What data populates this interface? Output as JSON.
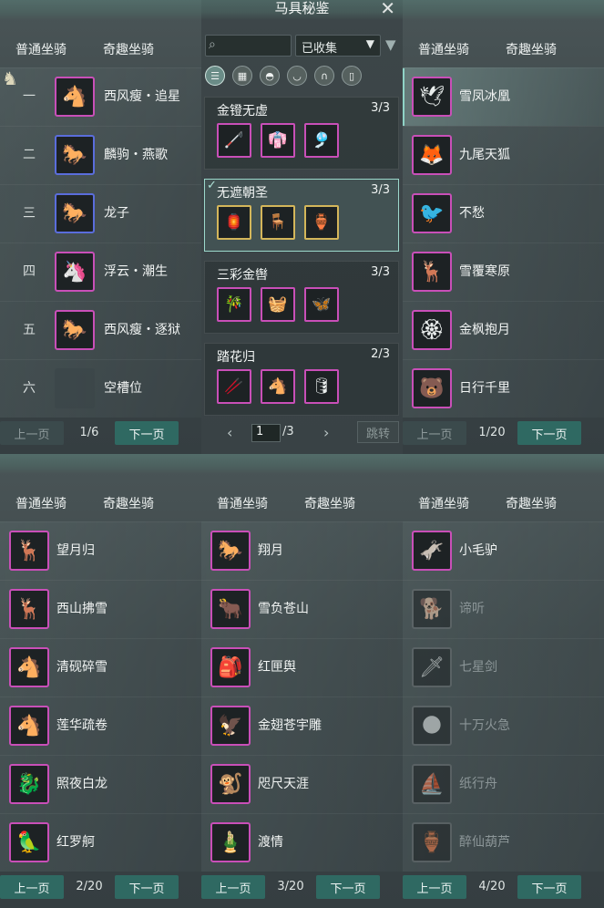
{
  "center": {
    "title": "马具秘鉴",
    "search_placeholder": "",
    "filter_selected": "已收集",
    "category_icons": [
      "list-icon",
      "grid-icon",
      "saddle-icon",
      "stirrup-icon",
      "horseshoe-icon",
      "shield-icon"
    ],
    "sets": [
      {
        "name": "金镫无虚",
        "count": "3/3",
        "selected": false,
        "items": [
          "🦯",
          "👘",
          "🎐"
        ],
        "gold": false
      },
      {
        "name": "无遮朝圣",
        "count": "3/3",
        "selected": true,
        "items": [
          "🏮",
          "🪑",
          "🏺"
        ],
        "gold": true
      },
      {
        "name": "三彩金辔",
        "count": "3/3",
        "selected": false,
        "items": [
          "🎋",
          "🧺",
          "🦋"
        ],
        "gold": false
      },
      {
        "name": "踏花归",
        "count": "2/3",
        "selected": false,
        "items": [
          "🥢",
          "🐴",
          "🛢"
        ],
        "gold": false
      }
    ],
    "page_input": "1",
    "page_total": "/3",
    "jump_label": "跳转"
  },
  "tabs": {
    "normal": "普通坐骑",
    "fun": "奇趣坐骑"
  },
  "pager": {
    "prev": "上一页",
    "next": "下一页"
  },
  "panel_ranked": {
    "rows": [
      {
        "rank": "一",
        "name": "西风瘦・追星",
        "icon": "🐴",
        "frame": "pink"
      },
      {
        "rank": "二",
        "name": "麟驹・燕歌",
        "icon": "🐎",
        "frame": "blue"
      },
      {
        "rank": "三",
        "name": "龙子",
        "icon": "🐎",
        "frame": "blue"
      },
      {
        "rank": "四",
        "name": "浮云・潮生",
        "icon": "🦄",
        "frame": "pink"
      },
      {
        "rank": "五",
        "name": "西风瘦・逐狱",
        "icon": "🐎",
        "frame": "pink"
      },
      {
        "rank": "六",
        "name": "空槽位",
        "icon": "",
        "frame": "empty"
      }
    ],
    "page": "1/6"
  },
  "panel_fun1": {
    "rows": [
      {
        "name": "雪凤冰凰",
        "icon": "🕊",
        "frame": "pink",
        "selected": true
      },
      {
        "name": "九尾天狐",
        "icon": "🦊",
        "frame": "pink"
      },
      {
        "name": "不愁",
        "icon": "🐦",
        "frame": "pink"
      },
      {
        "name": "雪覆寒原",
        "icon": "🦌",
        "frame": "pink"
      },
      {
        "name": "金枫抱月",
        "icon": "🏵",
        "frame": "pink"
      },
      {
        "name": "日行千里",
        "icon": "🐻",
        "frame": "pink"
      }
    ],
    "page": "1/20"
  },
  "panel_p2": {
    "rows": [
      {
        "name": "望月归",
        "icon": "🦌",
        "frame": "pink"
      },
      {
        "name": "西山拂雪",
        "icon": "🦌",
        "frame": "pink"
      },
      {
        "name": "清砚碎雪",
        "icon": "🐴",
        "frame": "pink"
      },
      {
        "name": "莲华疏卷",
        "icon": "🐴",
        "frame": "pink"
      },
      {
        "name": "照夜白龙",
        "icon": "🐉",
        "frame": "pink"
      },
      {
        "name": "红罗舸",
        "icon": "🦜",
        "frame": "pink"
      }
    ],
    "page": "2/20"
  },
  "panel_p3": {
    "rows": [
      {
        "name": "翔月",
        "icon": "🐎",
        "frame": "pink"
      },
      {
        "name": "雪负苍山",
        "icon": "🐂",
        "frame": "pink"
      },
      {
        "name": "红匣舆",
        "icon": "🎒",
        "frame": "pink"
      },
      {
        "name": "金翅苍宇雕",
        "icon": "🦅",
        "frame": "pink"
      },
      {
        "name": "咫尺天涯",
        "icon": "🐒",
        "frame": "pink"
      },
      {
        "name": "渡情",
        "icon": "🎍",
        "frame": "pink"
      }
    ],
    "page": "3/20"
  },
  "panel_p4": {
    "rows": [
      {
        "name": "小毛驴",
        "icon": "🫏",
        "frame": "pink",
        "dim": false
      },
      {
        "name": "谛听",
        "icon": "🐕",
        "frame": "grey",
        "dim": true
      },
      {
        "name": "七星剑",
        "icon": "🗡",
        "frame": "grey",
        "dim": true
      },
      {
        "name": "十万火急",
        "icon": "🌑",
        "frame": "grey",
        "dim": true
      },
      {
        "name": "纸行舟",
        "icon": "⛵",
        "frame": "grey",
        "dim": true
      },
      {
        "name": "醉仙葫芦",
        "icon": "🏺",
        "frame": "grey",
        "dim": true
      }
    ],
    "page": "4/20"
  }
}
